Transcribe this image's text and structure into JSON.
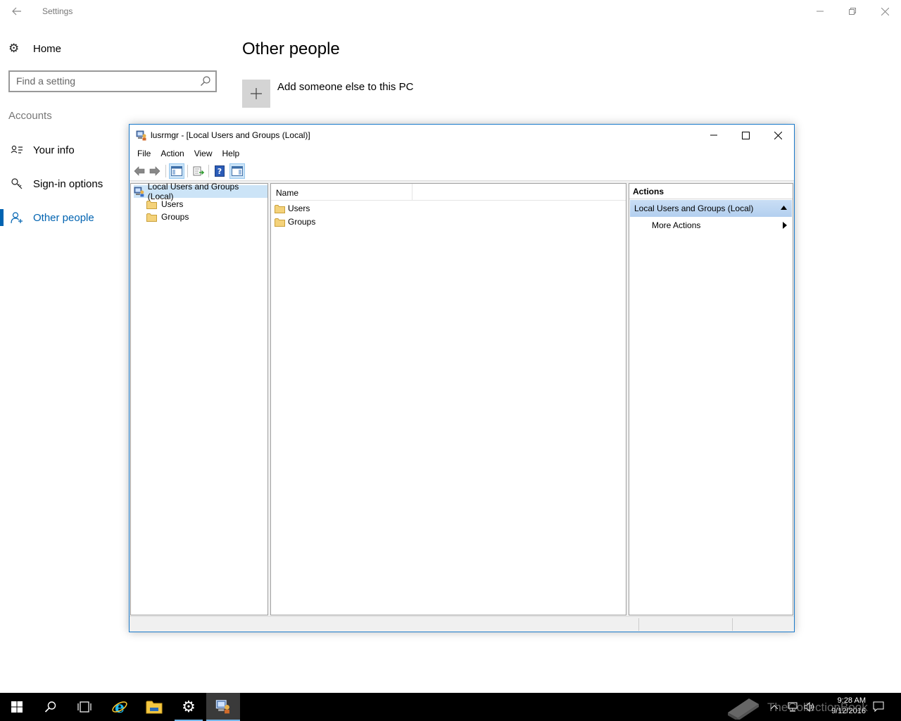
{
  "settings": {
    "title": "Settings",
    "home_label": "Home",
    "search_placeholder": "Find a setting",
    "section_label": "Accounts",
    "nav": [
      {
        "label": "Your info"
      },
      {
        "label": "Sign-in options"
      },
      {
        "label": "Other people"
      }
    ],
    "page_heading": "Other people",
    "add_label": "Add someone else to this PC",
    "accent_color": "#0063b1"
  },
  "mmc": {
    "title": "lusrmgr - [Local Users and Groups (Local)]",
    "menu": [
      "File",
      "Action",
      "View",
      "Help"
    ],
    "tree": {
      "root": "Local Users and Groups (Local)",
      "children": [
        "Users",
        "Groups"
      ]
    },
    "list": {
      "column_name": "Name",
      "rows": [
        "Users",
        "Groups"
      ]
    },
    "actions": {
      "header": "Actions",
      "group": "Local Users and Groups (Local)",
      "item": "More Actions"
    }
  },
  "taskbar": {
    "time": "9:28 AM",
    "date": "9/12/2016",
    "watermark": "TheCollectionBook"
  }
}
